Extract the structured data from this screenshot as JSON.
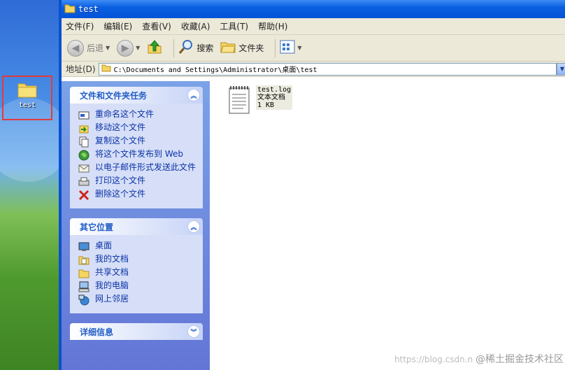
{
  "desktop": {
    "icon_label": "test"
  },
  "window": {
    "title": "test"
  },
  "menu": [
    "文件(F)",
    "编辑(E)",
    "查看(V)",
    "收藏(A)",
    "工具(T)",
    "帮助(H)"
  ],
  "toolbar": {
    "back": "后退",
    "search": "搜索",
    "folders": "文件夹"
  },
  "address": {
    "label": "地址(D)",
    "path": "C:\\Documents and Settings\\Administrator\\桌面\\test"
  },
  "tasks_panel": {
    "title": "文件和文件夹任务",
    "items": [
      "重命名这个文件",
      "移动这个文件",
      "复制这个文件",
      "将这个文件发布到 Web",
      "以电子邮件形式发送此文件",
      "打印这个文件",
      "删除这个文件"
    ]
  },
  "places_panel": {
    "title": "其它位置",
    "items": [
      "桌面",
      "我的文档",
      "共享文档",
      "我的电脑",
      "网上邻居"
    ]
  },
  "details_panel": {
    "title": "详细信息"
  },
  "file": {
    "name": "test.log",
    "type": "文本文档",
    "size": "1 KB"
  },
  "watermark": {
    "url": "https://blog.csdn.n",
    "brand": "@稀土掘金技术社区"
  }
}
